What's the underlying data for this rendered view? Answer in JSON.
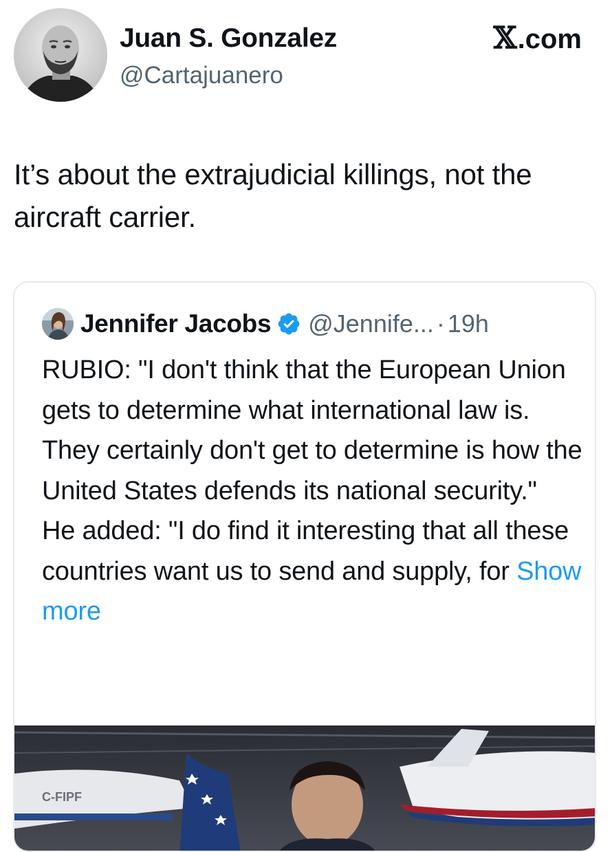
{
  "tweet": {
    "author_name": "Juan S. Gonzalez",
    "author_handle": "@Cartajuanero",
    "site_badge": ".com",
    "text": "It’s about the extrajudicial killings, not the aircraft carrier."
  },
  "quote": {
    "author_name": "Jennifer Jacobs",
    "author_handle": "@Jennife...",
    "separator": "·",
    "time": "19h",
    "body_lines": [
      "RUBIO: \"I don't think that the European Union gets to determine what international law is. They certainly don't get to determine is how the United States defends its national security.\"",
      "He added: \"I do find it interesting that all these countries want us to send and supply, for"
    ],
    "show_more": "Show more",
    "media_plane_registration": "C-FIPF"
  },
  "icons": {
    "logo": "x-logo",
    "verified": "verified-badge-icon"
  },
  "colors": {
    "text": "#0f1419",
    "secondary": "#536471",
    "link": "#1d9bf0",
    "border": "#e7e9ea"
  }
}
